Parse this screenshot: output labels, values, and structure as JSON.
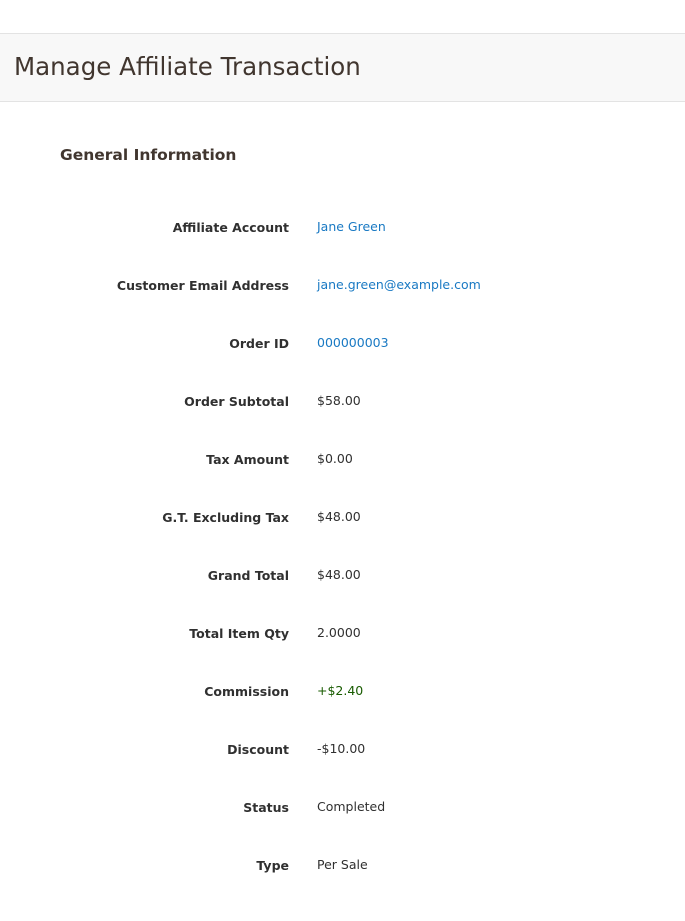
{
  "header": {
    "title": "Manage Affiliate Transaction"
  },
  "section": {
    "title": "General Information"
  },
  "fields": {
    "affiliate_account": {
      "label": "Affiliate Account",
      "value": "Jane Green"
    },
    "customer_email": {
      "label": "Customer Email Address",
      "value": "jane.green@example.com"
    },
    "order_id": {
      "label": "Order ID",
      "value": "000000003"
    },
    "order_subtotal": {
      "label": "Order Subtotal",
      "value": "$58.00"
    },
    "tax_amount": {
      "label": "Tax Amount",
      "value": "$0.00"
    },
    "gt_excluding_tax": {
      "label": "G.T. Excluding Tax",
      "value": "$48.00"
    },
    "grand_total": {
      "label": "Grand Total",
      "value": "$48.00"
    },
    "total_item_qty": {
      "label": "Total Item Qty",
      "value": "2.0000"
    },
    "commission": {
      "label": "Commission",
      "value": "+$2.40"
    },
    "discount": {
      "label": "Discount",
      "value": "-$10.00"
    },
    "status": {
      "label": "Status",
      "value": "Completed"
    },
    "type": {
      "label": "Type",
      "value": "Per Sale"
    }
  },
  "colors": {
    "link": "#1979c3",
    "positive": "#185b00",
    "title": "#41362f",
    "header_bg": "#f8f8f8"
  }
}
